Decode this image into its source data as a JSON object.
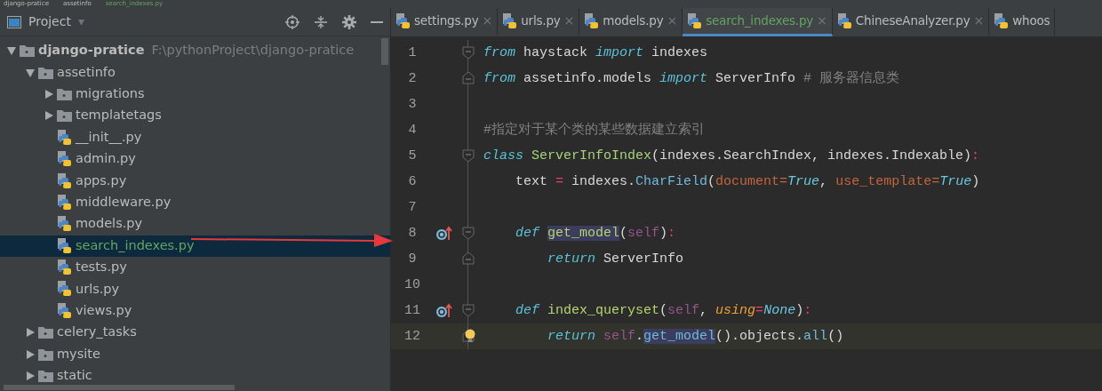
{
  "breadcrumb": [
    "django-pratice",
    "assetinfo",
    "search_indexes.py"
  ],
  "project_panel": {
    "title": "Project",
    "dropdown_glyph": "▾"
  },
  "tree": [
    {
      "label": "django-pratice",
      "path": "F:\\pythonProject\\django-pratice",
      "kind": "folder",
      "expanded": true,
      "selected": false,
      "children": [
        {
          "label": "assetinfo",
          "kind": "folder",
          "expanded": true,
          "selected": false,
          "children": [
            {
              "label": "migrations",
              "kind": "folder",
              "expanded": false,
              "selected": false
            },
            {
              "label": "templatetags",
              "kind": "folder",
              "expanded": false,
              "selected": false
            },
            {
              "label": "__init__.py",
              "kind": "python",
              "selected": false
            },
            {
              "label": "admin.py",
              "kind": "python",
              "selected": false
            },
            {
              "label": "apps.py",
              "kind": "python",
              "selected": false
            },
            {
              "label": "middleware.py",
              "kind": "python",
              "selected": false
            },
            {
              "label": "models.py",
              "kind": "python",
              "selected": false
            },
            {
              "label": "search_indexes.py",
              "kind": "python",
              "selected": true
            },
            {
              "label": "tests.py",
              "kind": "python",
              "selected": false
            },
            {
              "label": "urls.py",
              "kind": "python",
              "selected": false
            },
            {
              "label": "views.py",
              "kind": "python",
              "selected": false
            }
          ]
        },
        {
          "label": "celery_tasks",
          "kind": "folder",
          "expanded": false,
          "selected": false
        },
        {
          "label": "mysite",
          "kind": "folder",
          "expanded": false,
          "selected": false
        },
        {
          "label": "static",
          "kind": "folder",
          "expanded": false,
          "selected": false
        }
      ]
    }
  ],
  "tabs": [
    {
      "label": "settings.py",
      "close": "×",
      "selected": false
    },
    {
      "label": "urls.py",
      "close": "×",
      "selected": false
    },
    {
      "label": "models.py",
      "close": "×",
      "selected": false
    },
    {
      "label": "search_indexes.py",
      "close": "×",
      "selected": true
    },
    {
      "label": "ChineseAnalyzer.py",
      "close": "×",
      "selected": false
    },
    {
      "label": "whoos",
      "selected": false
    }
  ],
  "code_lines": [
    {
      "number": "1",
      "fold_start": true,
      "tokens": [
        {
          "kind": "keyword",
          "t": "from "
        },
        {
          "kind": "plain",
          "t": "haystack "
        },
        {
          "kind": "keyword",
          "t": "import "
        },
        {
          "kind": "plain",
          "t": "indexes"
        }
      ]
    },
    {
      "number": "2",
      "fold_end": true,
      "tokens": [
        {
          "kind": "keyword",
          "t": "from "
        },
        {
          "kind": "plain",
          "t": "assetinfo.models "
        },
        {
          "kind": "keyword",
          "t": "import "
        },
        {
          "kind": "plain",
          "t": "ServerInfo "
        },
        {
          "kind": "comment",
          "t": "# 服务器信息类"
        }
      ]
    },
    {
      "number": "3"
    },
    {
      "number": "4",
      "tokens": [
        {
          "kind": "comment",
          "t": "#指定对于某个类的某些数据建立索引"
        }
      ]
    },
    {
      "number": "5",
      "fold_start": true,
      "tokens": [
        {
          "kind": "keyword",
          "t": "class "
        },
        {
          "kind": "classname",
          "t": "ServerInfoIndex"
        },
        {
          "kind": "plain",
          "t": "(indexes.SearchIndex, indexes.Indexable)"
        },
        {
          "kind": "operator",
          "t": ":"
        }
      ]
    },
    {
      "number": "6",
      "tokens": [
        {
          "kind": "plain",
          "t": "    text "
        },
        {
          "kind": "operator",
          "t": "="
        },
        {
          "kind": "plain",
          "t": " indexes."
        },
        {
          "kind": "call",
          "t": "CharField"
        },
        {
          "kind": "plain",
          "t": "("
        },
        {
          "kind": "argument",
          "t": "document="
        },
        {
          "kind": "constant",
          "t": "True"
        },
        {
          "kind": "plain",
          "t": ", "
        },
        {
          "kind": "argument",
          "t": "use_template="
        },
        {
          "kind": "constant",
          "t": "True"
        },
        {
          "kind": "plain",
          "t": ")"
        }
      ]
    },
    {
      "number": "7"
    },
    {
      "number": "8",
      "override": true,
      "fold_start": true,
      "tokens": [
        {
          "kind": "keyword",
          "t": "    def "
        },
        {
          "kind": "function_highlighted",
          "t": "get_model"
        },
        {
          "kind": "plain",
          "t": "("
        },
        {
          "kind": "self",
          "t": "self"
        },
        {
          "kind": "plain",
          "t": ")"
        },
        {
          "kind": "operator",
          "t": ":"
        }
      ]
    },
    {
      "number": "9",
      "fold_end": true,
      "tokens": [
        {
          "kind": "keyword",
          "t": "        return "
        },
        {
          "kind": "plain",
          "t": "ServerInfo"
        }
      ]
    },
    {
      "number": "10"
    },
    {
      "number": "11",
      "override": true,
      "fold_start": true,
      "tokens": [
        {
          "kind": "keyword",
          "t": "    def "
        },
        {
          "kind": "function",
          "t": "index_queryset"
        },
        {
          "kind": "plain",
          "t": "("
        },
        {
          "kind": "self",
          "t": "self"
        },
        {
          "kind": "plain",
          "t": ", "
        },
        {
          "kind": "parameter",
          "t": "using"
        },
        {
          "kind": "operator",
          "t": "="
        },
        {
          "kind": "constant",
          "t": "None"
        },
        {
          "kind": "plain",
          "t": ")"
        },
        {
          "kind": "operator",
          "t": ":"
        }
      ]
    },
    {
      "number": "12",
      "current": true,
      "bulb": true,
      "fold_end": true,
      "tokens": [
        {
          "kind": "keyword",
          "t": "        return "
        },
        {
          "kind": "self",
          "t": "self"
        },
        {
          "kind": "plain",
          "t": "."
        },
        {
          "kind": "call_highlighted",
          "t": "get_model"
        },
        {
          "kind": "plain",
          "t": "().objects."
        },
        {
          "kind": "call",
          "t": "all"
        },
        {
          "kind": "plain",
          "t": "()"
        }
      ]
    }
  ]
}
